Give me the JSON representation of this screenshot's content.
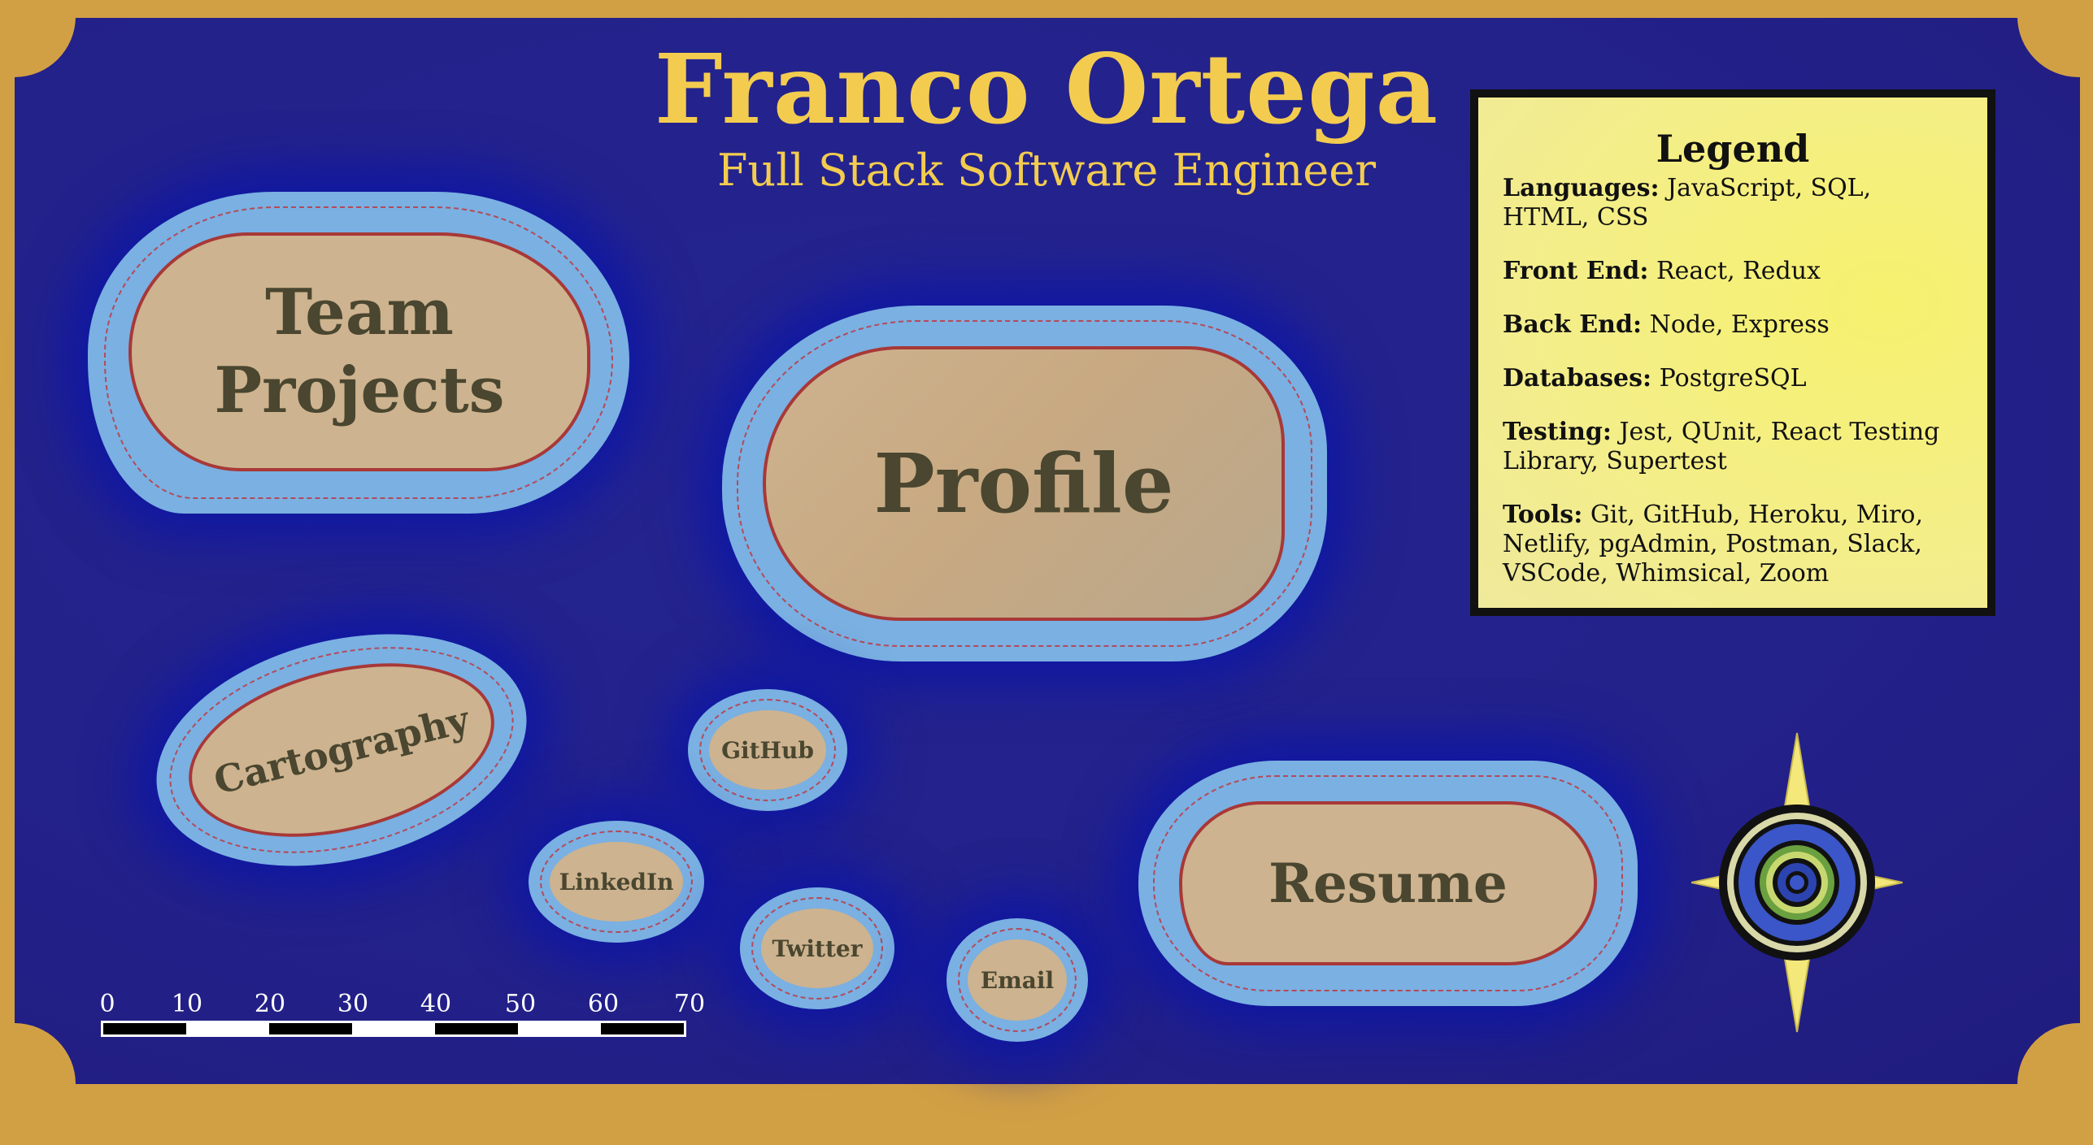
{
  "header": {
    "name": "Franco Ortega",
    "subtitle": "Full Stack Software Engineer"
  },
  "islands": {
    "team_projects": "Team Projects",
    "profile": "Profile",
    "cartography": "Cartography",
    "github": "GitHub",
    "linkedin": "LinkedIn",
    "twitter": "Twitter",
    "email": "Email",
    "resume": "Resume"
  },
  "legend": {
    "title": "Legend",
    "items": [
      {
        "label": "Languages:",
        "value": "JavaScript, SQL, HTML, CSS"
      },
      {
        "label": "Front End:",
        "value": "React, Redux"
      },
      {
        "label": "Back End:",
        "value": "Node, Express"
      },
      {
        "label": "Databases:",
        "value": "PostgreSQL"
      },
      {
        "label": "Testing:",
        "value": "Jest, QUnit, React Testing Library, Supertest"
      },
      {
        "label": "Tools:",
        "value": "Git, GitHub, Heroku, Miro, Netlify, pgAdmin, Postman, Slack, VSCode, Whimsical, Zoom"
      }
    ]
  },
  "scale": {
    "ticks": [
      "0",
      "10",
      "20",
      "30",
      "40",
      "50",
      "60",
      "70"
    ]
  },
  "colors": {
    "frame": "#d2a044",
    "sea": "#23218a",
    "water": "#7ab0e2",
    "land": "#cdb38f",
    "coast": "#a83838",
    "title": "#f3cc4f",
    "legend_bg": "#f4ee88"
  },
  "icons": [
    "compass-rose-icon"
  ]
}
